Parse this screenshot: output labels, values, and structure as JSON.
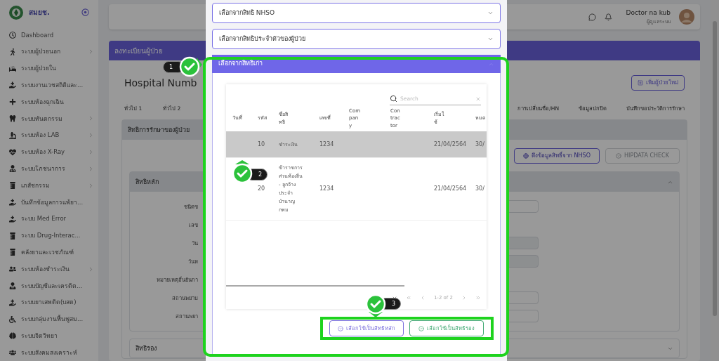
{
  "sidebar": {
    "logo_text": "สมยช.",
    "items": [
      {
        "label": "Dashboard",
        "has_submenu": false
      },
      {
        "label": "ระบบผู้ป่วยนอก",
        "has_submenu": true
      },
      {
        "label": "ระบบผู้ป่วยใน",
        "has_submenu": false
      },
      {
        "label": "ระบบงานเวชสถิติและ...",
        "has_submenu": false
      },
      {
        "label": "ระบบห้องฉุกเฉิน",
        "has_submenu": false
      },
      {
        "label": "ระบบทันตกรรม",
        "has_submenu": true
      },
      {
        "label": "ระบบห้อง LAB",
        "has_submenu": true
      },
      {
        "label": "ระบบห้อง X-Ray",
        "has_submenu": true
      },
      {
        "label": "ระบบโภชนาการ",
        "has_submenu": true
      },
      {
        "label": "เภสัชกรรม",
        "has_submenu": true
      },
      {
        "label": "บันทึกข้อมูลการแพ้ยา...",
        "has_submenu": false
      },
      {
        "label": "ระบบ Med Error",
        "has_submenu": false
      },
      {
        "label": "ระบบ Drug-Interac...",
        "has_submenu": false
      },
      {
        "label": "คลังยาและเวชภัณฑ์",
        "has_submenu": false
      },
      {
        "label": "ระบบห้องชำระเงิน",
        "has_submenu": true
      },
      {
        "label": "ระบบบัญชีและเครดิต...",
        "has_submenu": false
      },
      {
        "label": "ระบบยาเสพติด(บสต)",
        "has_submenu": false
      },
      {
        "label": "ระบบกลุ่มงานฟื้นฟูสม...",
        "has_submenu": false
      },
      {
        "label": "ระบบจิตวิทยา",
        "has_submenu": false
      },
      {
        "label": "ระบบสังคมสงเคราะห์",
        "has_submenu": false
      }
    ]
  },
  "header": {
    "user_name": "Doctor na kub",
    "user_role": "ผู้ดูแลระบบ"
  },
  "page": {
    "title": "ลงทะเบียนผู้ป่วย",
    "hospital_number_label": "Hospital Numb",
    "add_button": "เพิ่มผู้ป่วยใหม่",
    "tabs_left": [
      "ทั่วไป 1",
      "ทั่วไป 2"
    ],
    "tabs_right": [
      "การเปลี่ยนชื่อ/HN",
      "ข้อมูลปกปิด",
      "บันทึกขอประวัติการรักษา"
    ],
    "rights_title": "สิทธิการรักษาของผู้ป่วย",
    "nhso_button": "ดึงข้อมูลสิทธิ์จาก NHSO",
    "hipdata_button": {
      "label": "HIPDATA CHECK",
      "disabled": true
    },
    "main_rights": {
      "title": "สิทธิหลัก",
      "expanded": true,
      "fields": [
        {
          "label": "ชนิดข",
          "kind": "input"
        },
        {
          "label": "เลข",
          "kind": "none"
        },
        {
          "label": "วัน",
          "kind": "readonly"
        },
        {
          "label": "วันห",
          "kind": "readonly"
        },
        {
          "label": "หมายเหตุอื่นยันกา",
          "kind": "none"
        },
        {
          "label": "สถานพยาบ",
          "kind": "input"
        },
        {
          "label": "สถานพยา",
          "kind": "input"
        }
      ]
    },
    "secondary_rights": {
      "title": "สิทธิรอง",
      "expanded": false
    }
  },
  "modal": {
    "accordions": [
      {
        "title": "เลือกจากสิทธิ NHSO",
        "expanded": false
      },
      {
        "title": "เลือกจากสิทธิประจำตัวของผู้ป่วย",
        "expanded": false
      },
      {
        "title": "เลือกจากสิทธิเก่า",
        "expanded": true
      }
    ],
    "table": {
      "search_placeholder": "Search",
      "columns": [
        "วันที่",
        "รหัส",
        "ชื่อสิทธิ",
        "เลขที่",
        "Company",
        "Contractor",
        "เริ่มใช้",
        "หมด"
      ],
      "rows": [
        {
          "selected": true,
          "cells": [
            "",
            "10",
            "ชำระเงิน",
            "1234",
            "",
            "",
            "21/04/2564",
            "30/"
          ]
        },
        {
          "selected": false,
          "cells": [
            "",
            "20",
            "ข้าราชการส่วนท้องถิ่น - ลูกจ้างประจำบำนาญ กทม",
            "1234",
            "",
            "",
            "21/04/2564",
            "30/"
          ]
        }
      ],
      "pagination": "1-2 of 2"
    },
    "buttons": [
      {
        "label": "เลือกใช้เป็นสิทธิหลัก",
        "color": "#7a6fdc"
      },
      {
        "label": "เลือกใช้เป็นสิทธิรอง",
        "color": "#3fa872"
      }
    ]
  },
  "annotations": [
    {
      "number": "1"
    },
    {
      "number": "2"
    },
    {
      "number": "3"
    }
  ]
}
